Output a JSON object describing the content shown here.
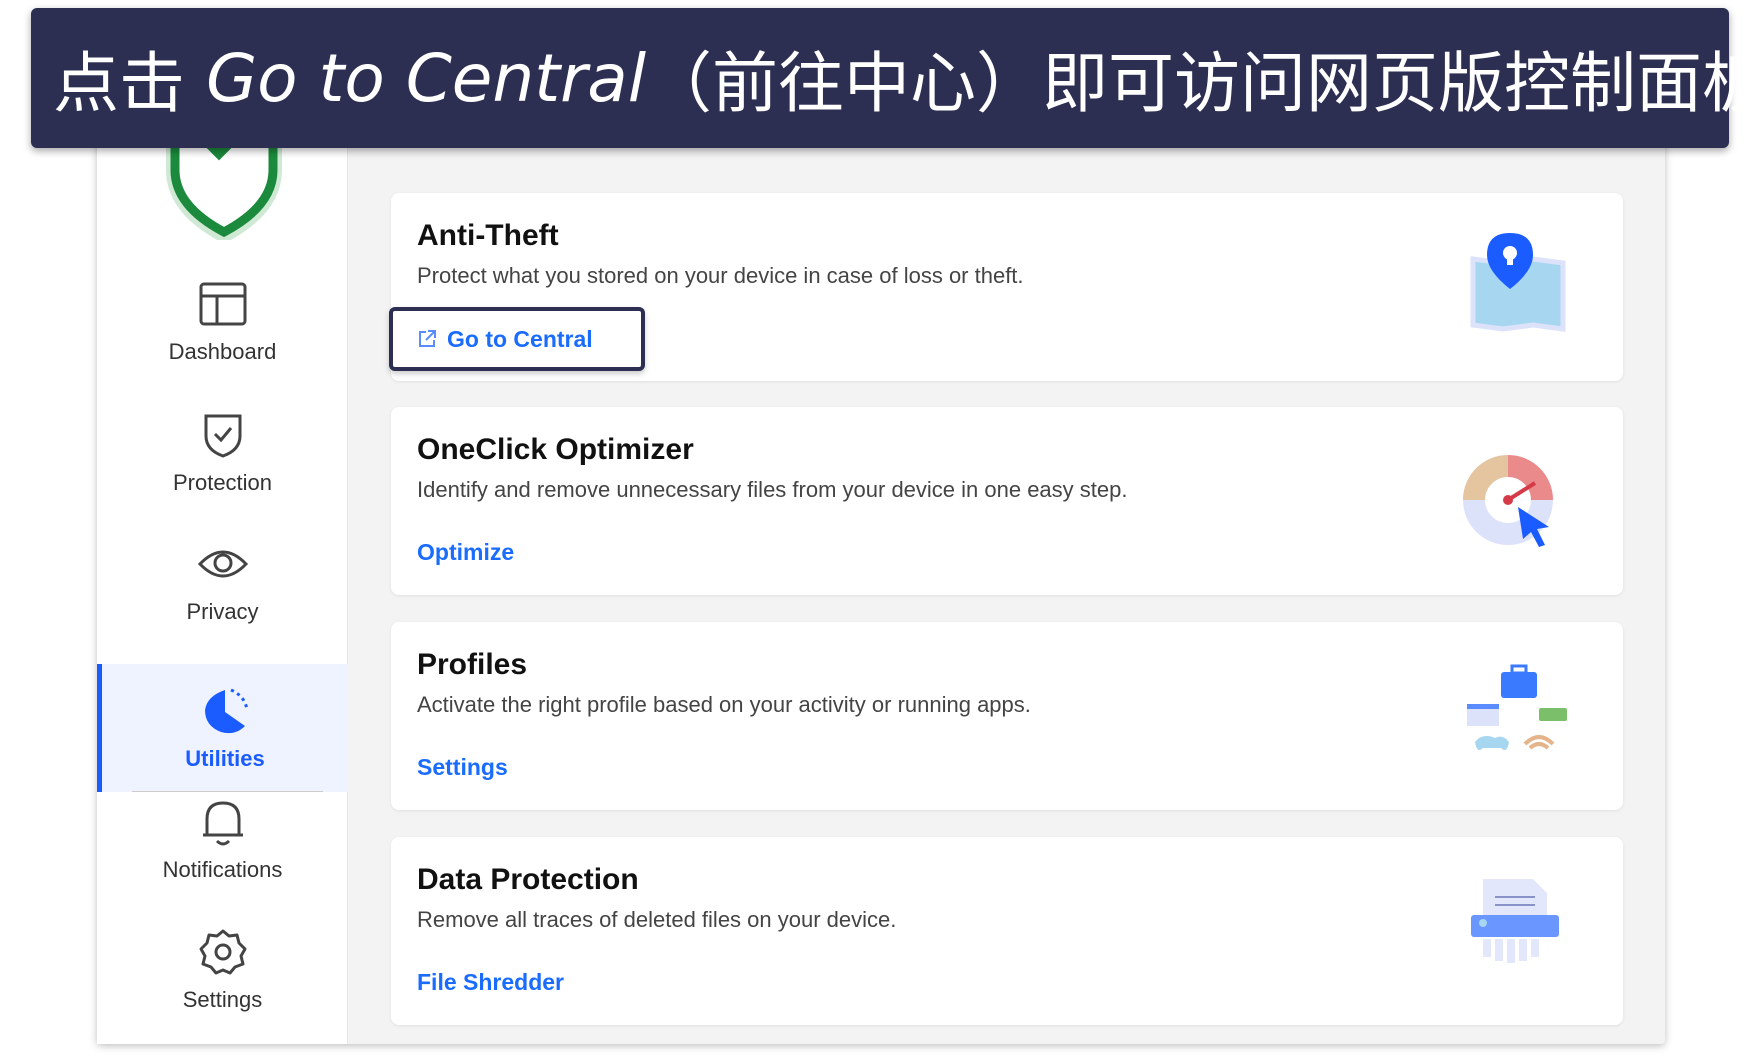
{
  "banner": {
    "prefix": "点击 ",
    "emphasis": "Go to Central",
    "suffix": "（前往中心）即可访问网页版控制面板"
  },
  "sidebar": {
    "items": [
      {
        "label": "Dashboard",
        "icon": "dashboard-icon"
      },
      {
        "label": "Protection",
        "icon": "shield-check-icon"
      },
      {
        "label": "Privacy",
        "icon": "eye-icon"
      },
      {
        "label": "Utilities",
        "icon": "utilities-icon",
        "active": true
      },
      {
        "label": "Notifications",
        "icon": "bell-icon"
      },
      {
        "label": "Settings",
        "icon": "gear-icon"
      }
    ]
  },
  "cards": [
    {
      "title": "Anti-Theft",
      "desc": "Protect what you stored on your device in case of loss or theft.",
      "action": "Go to Central",
      "icon": "map-pin-icon"
    },
    {
      "title": "OneClick Optimizer",
      "desc": "Identify and remove unnecessary files from your device in one easy step.",
      "action": "Optimize",
      "icon": "speedometer-icon"
    },
    {
      "title": "Profiles",
      "desc": "Activate the right profile based on your activity or running apps.",
      "action": "Settings",
      "icon": "profiles-icon"
    },
    {
      "title": "Data Protection",
      "desc": "Remove all traces of deleted files on your device.",
      "action": "File Shredder",
      "icon": "shredder-icon"
    }
  ],
  "colors": {
    "accent": "#1a6cff",
    "banner": "#2d2f52",
    "logo": "#1b8a3c"
  }
}
